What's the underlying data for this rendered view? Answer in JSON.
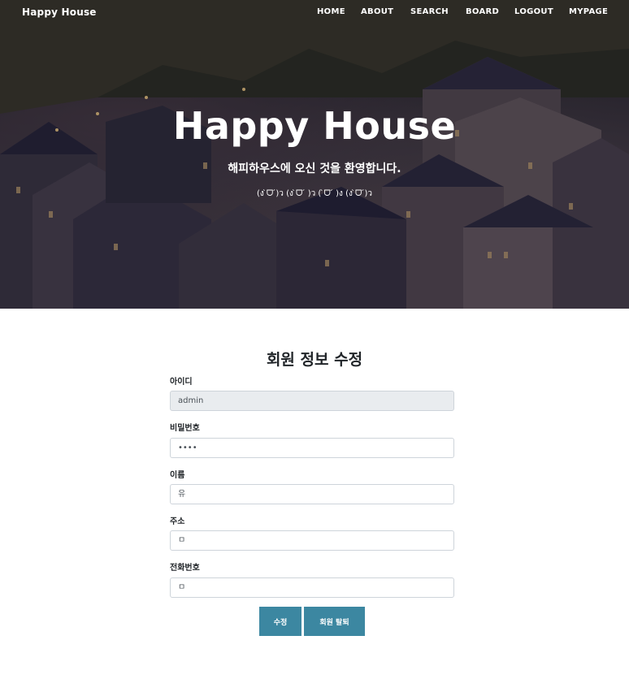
{
  "nav": {
    "brand": "Happy House",
    "items": [
      "HOME",
      "ABOUT",
      "SEARCH",
      "BOARD",
      "LOGOUT",
      "MYPAGE"
    ]
  },
  "hero": {
    "title": "Happy House",
    "subtitle": "해피하우스에 오신 것을 환영합니다.",
    "face": "(ง ̀ᗜ ́)ว (ง ̀ᗜ ́ )ว ( ̀ᗜ ́ )ง (ง ̀ᗜ ́)ว"
  },
  "form": {
    "title": "회원 정보 수정",
    "fields": [
      {
        "label": "아이디",
        "value": "admin"
      },
      {
        "label": "비밀번호",
        "value": "••••"
      },
      {
        "label": "이름",
        "value": "유"
      },
      {
        "label": "주소",
        "value": "ㅁ"
      },
      {
        "label": "전화번호",
        "value": "ㅁ"
      }
    ],
    "buttons": {
      "update": "수정",
      "withdraw": "회원 탈퇴"
    }
  },
  "colors": {
    "accent": "#3c87a1",
    "readonly_bg": "#e9ecef",
    "border": "#ced4da"
  }
}
